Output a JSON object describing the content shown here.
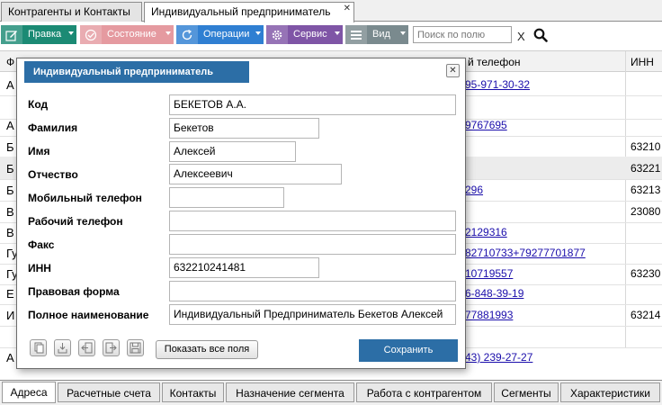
{
  "top_tabs": [
    {
      "label": "Контрагенты и Контакты"
    },
    {
      "label": "Индивидуальный предприниматель",
      "close": "✕"
    }
  ],
  "toolbar": {
    "buttons": [
      {
        "label": "Правка",
        "color": "#1b8a74",
        "icon": "edit-icon"
      },
      {
        "label": "Состояние",
        "color": "#e59aa0",
        "icon": "check-circle-icon"
      },
      {
        "label": "Операции",
        "color": "#2f7fd2",
        "icon": "refresh-icon"
      },
      {
        "label": "Сервис",
        "color": "#7f55a6",
        "icon": "gear-icon"
      },
      {
        "label": "Вид",
        "color": "#7a8a8e",
        "icon": "view-icon"
      }
    ],
    "search_placeholder": "Поиск по полю",
    "clear_label": "X"
  },
  "grid": {
    "headers": [
      "Ф",
      "й телефон",
      "ИНН"
    ],
    "rows": [
      {
        "name": "А",
        "phone": "95-971-30-32",
        "inn": ""
      },
      {
        "name": "",
        "phone": "",
        "inn": ""
      },
      {
        "name": "А",
        "phone": "9767695",
        "inn": ""
      },
      {
        "name": "Б",
        "phone": "",
        "inn": "63210"
      },
      {
        "name": "Б",
        "phone": "",
        "inn": "63221",
        "selected": true
      },
      {
        "name": "Б",
        "phone": "296",
        "inn": "63213"
      },
      {
        "name": "В",
        "phone": "",
        "inn": "23080"
      },
      {
        "name": "В",
        "phone": "2129316",
        "inn": ""
      },
      {
        "name": "Гу",
        "phone": "82710733+79277701877",
        "inn": ""
      },
      {
        "name": "Гу",
        "phone": "10719557",
        "inn": "63230"
      },
      {
        "name": "Е",
        "phone": "6-848-39-19",
        "inn": ""
      },
      {
        "name": "И",
        "phone": "77881993",
        "inn": "63214"
      },
      {
        "name": "",
        "phone": "",
        "inn": ""
      },
      {
        "name": "А",
        "phone": "43) 239-27-27",
        "inn": ""
      }
    ]
  },
  "dialog": {
    "title": "Индивидуальный предприниматель",
    "close": "✕",
    "fields": [
      {
        "label": "Код",
        "value": "БЕКЕТОВ А.А."
      },
      {
        "label": "Фамилия",
        "value": "Бекетов"
      },
      {
        "label": "Имя",
        "value": "Алексей"
      },
      {
        "label": "Отчество",
        "value": "Алексеевич"
      },
      {
        "label": "Мобильный телефон",
        "value": ""
      },
      {
        "label": "Рабочий телефон",
        "value": ""
      },
      {
        "label": "Факс",
        "value": ""
      },
      {
        "label": "ИНН",
        "value": "632210241481"
      },
      {
        "label": "Правовая форма",
        "value": ""
      },
      {
        "label": "Полное наименование",
        "value": "Индивидуальный Предприниматель Бекетов Алексей"
      }
    ],
    "show_all_fields": "Показать все поля",
    "save": "Сохранить"
  },
  "bottom_tabs": [
    {
      "label": "Адреса"
    },
    {
      "label": "Расчетные счета"
    },
    {
      "label": "Контакты"
    },
    {
      "label": "Назначение сегмента"
    },
    {
      "label": "Работа с контрагентом"
    },
    {
      "label": "Сегменты"
    },
    {
      "label": "Характеристики"
    }
  ]
}
